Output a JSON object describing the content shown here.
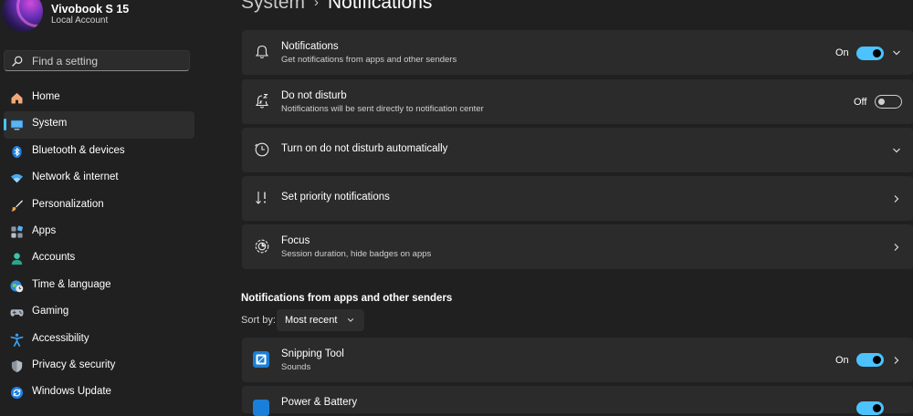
{
  "profile": {
    "name": "Vivobook S 15",
    "account_type": "Local Account"
  },
  "search": {
    "placeholder": "Find a setting"
  },
  "sidebar": {
    "items": [
      {
        "label": "Home",
        "icon": "home-icon"
      },
      {
        "label": "System",
        "icon": "system-icon",
        "selected": true
      },
      {
        "label": "Bluetooth & devices",
        "icon": "bluetooth-icon"
      },
      {
        "label": "Network & internet",
        "icon": "wifi-icon"
      },
      {
        "label": "Personalization",
        "icon": "brush-icon"
      },
      {
        "label": "Apps",
        "icon": "apps-icon"
      },
      {
        "label": "Accounts",
        "icon": "person-icon"
      },
      {
        "label": "Time & language",
        "icon": "globe-clock-icon"
      },
      {
        "label": "Gaming",
        "icon": "gamepad-icon"
      },
      {
        "label": "Accessibility",
        "icon": "accessibility-icon"
      },
      {
        "label": "Privacy & security",
        "icon": "shield-icon"
      },
      {
        "label": "Windows Update",
        "icon": "update-icon"
      }
    ]
  },
  "header": {
    "parent": "System",
    "separator": "›",
    "current": "Notifications"
  },
  "cards": {
    "notifications": {
      "title": "Notifications",
      "description": "Get notifications from apps and other senders",
      "state": "On"
    },
    "dnd": {
      "title": "Do not disturb",
      "description": "Notifications will be sent directly to notification center",
      "state": "Off"
    },
    "auto_dnd": {
      "title": "Turn on do not disturb automatically"
    },
    "priority": {
      "title": "Set priority notifications"
    },
    "focus": {
      "title": "Focus",
      "description": "Session duration, hide badges on apps"
    }
  },
  "senders": {
    "section_title": "Notifications from apps and other senders",
    "sort_label": "Sort by:",
    "sort_value": "Most recent",
    "apps": [
      {
        "name": "Snipping Tool",
        "description": "Sounds",
        "state": "On"
      },
      {
        "name": "Power & Battery"
      }
    ]
  },
  "colors": {
    "accent": "#4cc2ff",
    "background": "#202020",
    "card": "#2b2b2b"
  }
}
